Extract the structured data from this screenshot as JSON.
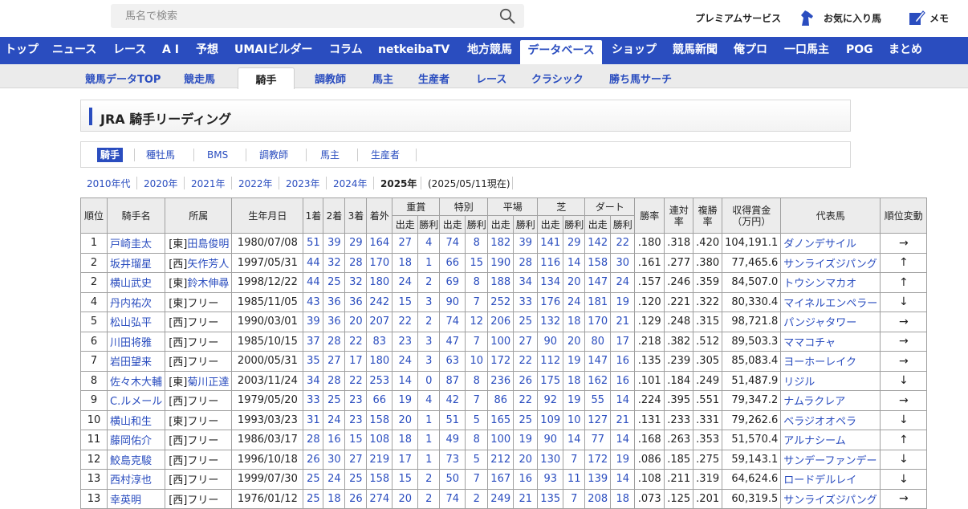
{
  "header": {
    "search_placeholder": "馬名で検索",
    "premium": "プレミアムサービス",
    "favorites": "お気に入り馬",
    "memo": "メモ"
  },
  "main_nav": [
    "トップ",
    "ニュース",
    "レース",
    "A I",
    "予想",
    "UMAIビルダー",
    "コラム",
    "netkeibaTV",
    "地方競馬",
    "データベース",
    "ショップ",
    "競馬新聞",
    "俺プロ",
    "一口馬主",
    "POG",
    "まとめ"
  ],
  "main_nav_active": "データベース",
  "sub_nav": [
    "競馬データTOP",
    "競走馬",
    "騎手",
    "調教師",
    "馬主",
    "生産者",
    "レース",
    "クラシック",
    "勝ち馬サーチ"
  ],
  "sub_nav_active": "騎手",
  "page_title": "JRA 騎手リーディング",
  "category_tabs": [
    "騎手",
    "種牡馬",
    "BMS",
    "調教師",
    "馬主",
    "生産者"
  ],
  "year_tabs": [
    "2010年代",
    "2020年",
    "2021年",
    "2022年",
    "2023年",
    "2024年",
    "2025年"
  ],
  "year_active": "2025年",
  "as_of": "(2025/05/11現在)",
  "table": {
    "headers": {
      "rank": "順位",
      "name": "騎手名",
      "affiliation": "所属",
      "birth": "生年月日",
      "first": "1着",
      "second": "2着",
      "third": "3着",
      "unplaced": "着外",
      "graded": "重賞",
      "special": "特別",
      "flat": "平場",
      "turf": "芝",
      "dirt": "ダート",
      "starts": "出走",
      "wins": "勝利",
      "win_rate": "勝率",
      "place_rate": "連対率",
      "show_rate": "複勝率",
      "earnings": "収得賞金（万円）",
      "rep_horse": "代表馬",
      "rank_change": "順位変動"
    },
    "rows": [
      {
        "rank": "1",
        "name": "戸崎圭太",
        "region": "[東]",
        "trainer": "田島俊明",
        "birth": "1980/07/08",
        "c1": "51",
        "c2": "39",
        "c3": "29",
        "cx": "164",
        "gs": "27",
        "gw": "4",
        "ss": "74",
        "sw": "8",
        "fs": "182",
        "fw": "39",
        "ts": "141",
        "tw": "29",
        "ds": "142",
        "dw": "22",
        "wr": ".180",
        "pr": ".318",
        "sr": ".420",
        "prize": "104,191.1",
        "horse": "ダノンデサイル",
        "change": "→"
      },
      {
        "rank": "2",
        "name": "坂井瑠星",
        "region": "[西]",
        "trainer": "矢作芳人",
        "birth": "1997/05/31",
        "c1": "44",
        "c2": "32",
        "c3": "28",
        "cx": "170",
        "gs": "18",
        "gw": "1",
        "ss": "66",
        "sw": "15",
        "fs": "190",
        "fw": "28",
        "ts": "116",
        "tw": "14",
        "ds": "158",
        "dw": "30",
        "wr": ".161",
        "pr": ".277",
        "sr": ".380",
        "prize": "77,465.6",
        "horse": "サンライズジパング",
        "change": "↑"
      },
      {
        "rank": "2",
        "name": "横山武史",
        "region": "[東]",
        "trainer": "鈴木伸尋",
        "birth": "1998/12/22",
        "c1": "44",
        "c2": "25",
        "c3": "32",
        "cx": "180",
        "gs": "24",
        "gw": "2",
        "ss": "69",
        "sw": "8",
        "fs": "188",
        "fw": "34",
        "ts": "134",
        "tw": "20",
        "ds": "147",
        "dw": "24",
        "wr": ".157",
        "pr": ".246",
        "sr": ".359",
        "prize": "84,507.0",
        "horse": "トウシンマカオ",
        "change": "↑"
      },
      {
        "rank": "4",
        "name": "丹内祐次",
        "region": "[東]",
        "trainer": "フリー",
        "birth": "1985/11/05",
        "c1": "43",
        "c2": "36",
        "c3": "36",
        "cx": "242",
        "gs": "15",
        "gw": "3",
        "ss": "90",
        "sw": "7",
        "fs": "252",
        "fw": "33",
        "ts": "176",
        "tw": "24",
        "ds": "181",
        "dw": "19",
        "wr": ".120",
        "pr": ".221",
        "sr": ".322",
        "prize": "80,330.4",
        "horse": "マイネルエンペラー",
        "change": "↓"
      },
      {
        "rank": "5",
        "name": "松山弘平",
        "region": "[西]",
        "trainer": "フリー",
        "birth": "1990/03/01",
        "c1": "39",
        "c2": "36",
        "c3": "20",
        "cx": "207",
        "gs": "22",
        "gw": "2",
        "ss": "74",
        "sw": "12",
        "fs": "206",
        "fw": "25",
        "ts": "132",
        "tw": "18",
        "ds": "170",
        "dw": "21",
        "wr": ".129",
        "pr": ".248",
        "sr": ".315",
        "prize": "98,721.8",
        "horse": "パンジャタワー",
        "change": "→"
      },
      {
        "rank": "6",
        "name": "川田将雅",
        "region": "[西]",
        "trainer": "フリー",
        "birth": "1985/10/15",
        "c1": "37",
        "c2": "28",
        "c3": "22",
        "cx": "83",
        "gs": "23",
        "gw": "3",
        "ss": "47",
        "sw": "7",
        "fs": "100",
        "fw": "27",
        "ts": "90",
        "tw": "20",
        "ds": "80",
        "dw": "17",
        "wr": ".218",
        "pr": ".382",
        "sr": ".512",
        "prize": "89,503.3",
        "horse": "ママコチャ",
        "change": "→"
      },
      {
        "rank": "7",
        "name": "岩田望来",
        "region": "[西]",
        "trainer": "フリー",
        "birth": "2000/05/31",
        "c1": "35",
        "c2": "27",
        "c3": "17",
        "cx": "180",
        "gs": "24",
        "gw": "3",
        "ss": "63",
        "sw": "10",
        "fs": "172",
        "fw": "22",
        "ts": "112",
        "tw": "19",
        "ds": "147",
        "dw": "16",
        "wr": ".135",
        "pr": ".239",
        "sr": ".305",
        "prize": "85,083.4",
        "horse": "ヨーホーレイク",
        "change": "→"
      },
      {
        "rank": "8",
        "name": "佐々木大輔",
        "region": "[東]",
        "trainer": "菊川正達",
        "birth": "2003/11/24",
        "c1": "34",
        "c2": "28",
        "c3": "22",
        "cx": "253",
        "gs": "14",
        "gw": "0",
        "ss": "87",
        "sw": "8",
        "fs": "236",
        "fw": "26",
        "ts": "175",
        "tw": "18",
        "ds": "162",
        "dw": "16",
        "wr": ".101",
        "pr": ".184",
        "sr": ".249",
        "prize": "51,487.9",
        "horse": "リジル",
        "change": "↓"
      },
      {
        "rank": "9",
        "name": "C.ルメール",
        "region": "[西]",
        "trainer": "フリー",
        "birth": "1979/05/20",
        "c1": "33",
        "c2": "25",
        "c3": "23",
        "cx": "66",
        "gs": "19",
        "gw": "4",
        "ss": "42",
        "sw": "7",
        "fs": "86",
        "fw": "22",
        "ts": "92",
        "tw": "19",
        "ds": "55",
        "dw": "14",
        "wr": ".224",
        "pr": ".395",
        "sr": ".551",
        "prize": "79,347.2",
        "horse": "ナムラクレア",
        "change": "→"
      },
      {
        "rank": "10",
        "name": "横山和生",
        "region": "[東]",
        "trainer": "フリー",
        "birth": "1993/03/23",
        "c1": "31",
        "c2": "24",
        "c3": "23",
        "cx": "158",
        "gs": "20",
        "gw": "1",
        "ss": "51",
        "sw": "5",
        "fs": "165",
        "fw": "25",
        "ts": "109",
        "tw": "10",
        "ds": "127",
        "dw": "21",
        "wr": ".131",
        "pr": ".233",
        "sr": ".331",
        "prize": "79,262.6",
        "horse": "ベラジオオペラ",
        "change": "↓"
      },
      {
        "rank": "11",
        "name": "藤岡佑介",
        "region": "[西]",
        "trainer": "フリー",
        "birth": "1986/03/17",
        "c1": "28",
        "c2": "16",
        "c3": "15",
        "cx": "108",
        "gs": "18",
        "gw": "1",
        "ss": "49",
        "sw": "8",
        "fs": "100",
        "fw": "19",
        "ts": "90",
        "tw": "14",
        "ds": "77",
        "dw": "14",
        "wr": ".168",
        "pr": ".263",
        "sr": ".353",
        "prize": "51,570.4",
        "horse": "アルナシーム",
        "change": "↑"
      },
      {
        "rank": "12",
        "name": "鮫島克駿",
        "region": "[西]",
        "trainer": "フリー",
        "birth": "1996/10/18",
        "c1": "26",
        "c2": "30",
        "c3": "27",
        "cx": "219",
        "gs": "17",
        "gw": "1",
        "ss": "73",
        "sw": "5",
        "fs": "212",
        "fw": "20",
        "ts": "130",
        "tw": "7",
        "ds": "172",
        "dw": "19",
        "wr": ".086",
        "pr": ".185",
        "sr": ".275",
        "prize": "59,143.1",
        "horse": "サンデーファンデー",
        "change": "↓"
      },
      {
        "rank": "13",
        "name": "西村淳也",
        "region": "[西]",
        "trainer": "フリー",
        "birth": "1999/07/30",
        "c1": "25",
        "c2": "24",
        "c3": "25",
        "cx": "158",
        "gs": "15",
        "gw": "2",
        "ss": "50",
        "sw": "7",
        "fs": "167",
        "fw": "16",
        "ts": "93",
        "tw": "11",
        "ds": "139",
        "dw": "14",
        "wr": ".108",
        "pr": ".211",
        "sr": ".319",
        "prize": "64,624.6",
        "horse": "ロードデルレイ",
        "change": "↓"
      },
      {
        "rank": "13",
        "name": "幸英明",
        "region": "[西]",
        "trainer": "フリー",
        "birth": "1976/01/12",
        "c1": "25",
        "c2": "18",
        "c3": "26",
        "cx": "274",
        "gs": "20",
        "gw": "2",
        "ss": "74",
        "sw": "2",
        "fs": "249",
        "fw": "21",
        "ts": "135",
        "tw": "7",
        "ds": "208",
        "dw": "18",
        "wr": ".073",
        "pr": ".125",
        "sr": ".201",
        "prize": "60,319.5",
        "horse": "サンライズジパング",
        "change": "→"
      }
    ]
  },
  "colors": {
    "brand": "#2a4dbf",
    "header_bg": "#ececec",
    "subnav_bg": "#ebebeb"
  }
}
